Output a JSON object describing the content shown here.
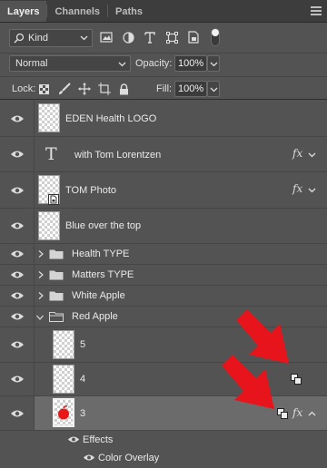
{
  "tabs": [
    {
      "label": "Layers",
      "active": true
    },
    {
      "label": "Channels",
      "active": false
    },
    {
      "label": "Paths",
      "active": false
    }
  ],
  "filter": {
    "kind_label": "Kind"
  },
  "blend": {
    "mode": "Normal",
    "opacity_label": "Opacity:",
    "opacity_value": "100%",
    "lock_label": "Lock:",
    "fill_label": "Fill:",
    "fill_value": "100%"
  },
  "layers": {
    "eden": {
      "name": "EDEN Health LOGO"
    },
    "tom_text": {
      "name": "with Tom Lorentzen",
      "fx": "fx"
    },
    "tom_photo": {
      "name": "TOM Photo",
      "fx": "fx"
    },
    "blue": {
      "name": "Blue over the top"
    },
    "health_type": {
      "name": "Health TYPE"
    },
    "matters_type": {
      "name": "Matters TYPE"
    },
    "white_apple": {
      "name": "White Apple"
    },
    "red_apple": {
      "name": "Red Apple"
    },
    "layer5": {
      "name": "5"
    },
    "layer4": {
      "name": "4"
    },
    "layer3": {
      "name": "3",
      "fx": "fx"
    },
    "effects": {
      "label": "Effects"
    },
    "color_overlay": {
      "label": "Color Overlay"
    }
  },
  "text_layer_glyph": "T",
  "colors": {
    "panel_bg": "#535353",
    "selected_row": "#6b6b6b",
    "annotation_arrow": "#e8141c",
    "apple_red": "#e81818"
  }
}
